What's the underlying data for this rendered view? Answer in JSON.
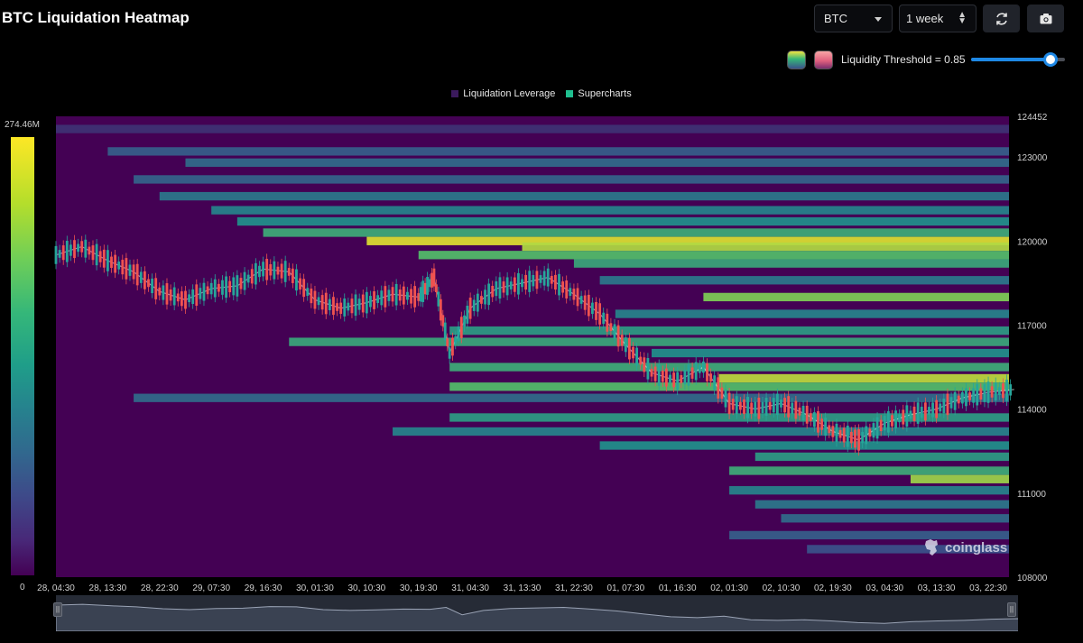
{
  "title": "BTC Liquidation Heatmap",
  "controls": {
    "coin": "BTC",
    "range": "1 week",
    "refresh_icon": "refresh-icon",
    "camera_icon": "camera-icon"
  },
  "threshold": {
    "label": "Liquidity Threshold = 0.85",
    "value": 0.85
  },
  "colors": {
    "background": "#000000",
    "heat_base": "#440154",
    "accent": "#1e88e5",
    "candle_up": "#26a69a",
    "candle_down": "#ef5350"
  },
  "legend": {
    "items": [
      {
        "label": "Liquidation Leverage",
        "color": "#3b1a5c"
      },
      {
        "label": "Supercharts",
        "color": "#1fbf8f"
      }
    ]
  },
  "colorbar": {
    "max_label": "274.46M",
    "min_label": "0"
  },
  "watermark": {
    "text": "coinglass",
    "icon": "coinglass-logo-icon"
  },
  "chart_data": {
    "type": "heatmap",
    "title": "BTC Liquidation Heatmap",
    "x_ticks": [
      "28, 04:30",
      "28, 13:30",
      "28, 22:30",
      "29, 07:30",
      "29, 16:30",
      "30, 01:30",
      "30, 10:30",
      "30, 19:30",
      "31, 04:30",
      "31, 13:30",
      "31, 22:30",
      "01, 07:30",
      "01, 16:30",
      "02, 01:30",
      "02, 10:30",
      "02, 19:30",
      "03, 04:30",
      "03, 13:30",
      "03, 22:30"
    ],
    "y_ticks": [
      124452,
      123000,
      120000,
      117000,
      114000,
      111000,
      108000
    ],
    "ylim": [
      108000,
      124452
    ],
    "colorbar_range": [
      0,
      274460000
    ],
    "price_path": [
      [
        0,
        119500
      ],
      [
        0.5,
        119800
      ],
      [
        1,
        119300
      ],
      [
        1.5,
        118900
      ],
      [
        2,
        118200
      ],
      [
        2.5,
        117900
      ],
      [
        3,
        118300
      ],
      [
        3.5,
        118400
      ],
      [
        4,
        119000
      ],
      [
        4.5,
        118900
      ],
      [
        5,
        117900
      ],
      [
        5.5,
        117600
      ],
      [
        6,
        117800
      ],
      [
        6.5,
        118100
      ],
      [
        7,
        118000
      ],
      [
        7.3,
        118700
      ],
      [
        7.6,
        116000
      ],
      [
        8,
        117600
      ],
      [
        8.5,
        118300
      ],
      [
        9,
        118500
      ],
      [
        9.5,
        118700
      ],
      [
        10,
        118100
      ],
      [
        10.5,
        117400
      ],
      [
        11,
        116300
      ],
      [
        11.5,
        115300
      ],
      [
        12,
        115000
      ],
      [
        12.5,
        115500
      ],
      [
        13,
        114200
      ],
      [
        13.5,
        114000
      ],
      [
        14,
        114200
      ],
      [
        14.5,
        113800
      ],
      [
        15,
        113200
      ],
      [
        15.5,
        112900
      ],
      [
        16,
        113500
      ],
      [
        16.5,
        113800
      ],
      [
        17,
        114000
      ],
      [
        17.5,
        114400
      ],
      [
        18,
        114600
      ],
      [
        18.5,
        114700
      ]
    ],
    "bands": [
      {
        "price": 124000,
        "start": 0,
        "level": 0.15
      },
      {
        "price": 123200,
        "start": 1.0,
        "level": 0.3
      },
      {
        "price": 122800,
        "start": 2.5,
        "level": 0.35
      },
      {
        "price": 122200,
        "start": 1.5,
        "level": 0.32
      },
      {
        "price": 121600,
        "start": 2.0,
        "level": 0.4
      },
      {
        "price": 121100,
        "start": 3.0,
        "level": 0.45
      },
      {
        "price": 120700,
        "start": 3.5,
        "level": 0.5
      },
      {
        "price": 120300,
        "start": 4.0,
        "level": 0.62
      },
      {
        "price": 120000,
        "start": 6.0,
        "level": 0.95
      },
      {
        "price": 119800,
        "start": 9.0,
        "level": 0.88
      },
      {
        "price": 119500,
        "start": 7.0,
        "level": 0.7
      },
      {
        "price": 119200,
        "start": 10.0,
        "level": 0.6
      },
      {
        "price": 118600,
        "start": 10.5,
        "level": 0.4
      },
      {
        "price": 118000,
        "start": 12.5,
        "level": 0.8
      },
      {
        "price": 117400,
        "start": 10.8,
        "level": 0.45
      },
      {
        "price": 116800,
        "start": 7.6,
        "level": 0.55
      },
      {
        "price": 116400,
        "start": 4.5,
        "level": 0.6
      },
      {
        "price": 116000,
        "start": 11.5,
        "level": 0.5
      },
      {
        "price": 115500,
        "start": 7.6,
        "level": 0.62
      },
      {
        "price": 115100,
        "start": 12.8,
        "level": 0.9
      },
      {
        "price": 114800,
        "start": 7.6,
        "level": 0.7
      },
      {
        "price": 114400,
        "start": 1.5,
        "level": 0.35
      },
      {
        "price": 113700,
        "start": 7.6,
        "level": 0.55
      },
      {
        "price": 113200,
        "start": 6.5,
        "level": 0.45
      },
      {
        "price": 112700,
        "start": 10.5,
        "level": 0.5
      },
      {
        "price": 112300,
        "start": 13.5,
        "level": 0.55
      },
      {
        "price": 111800,
        "start": 13.0,
        "level": 0.62
      },
      {
        "price": 111500,
        "start": 16.5,
        "level": 0.85
      },
      {
        "price": 111100,
        "start": 13.0,
        "level": 0.45
      },
      {
        "price": 110600,
        "start": 13.5,
        "level": 0.4
      },
      {
        "price": 110100,
        "start": 14.0,
        "level": 0.35
      },
      {
        "price": 109500,
        "start": 13.0,
        "level": 0.3
      },
      {
        "price": 109000,
        "start": 14.5,
        "level": 0.25
      }
    ]
  }
}
